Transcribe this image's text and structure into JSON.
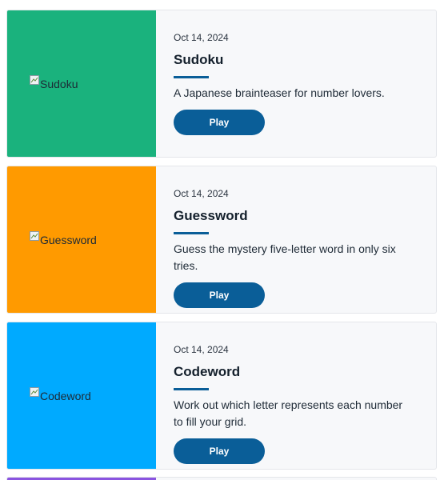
{
  "games": [
    {
      "image_alt": "Sudoku",
      "thumb_color": "#1ab27d",
      "date": "Oct 14, 2024",
      "title": "Sudoku",
      "description": "A Japanese brainteaser for number lovers.",
      "play_label": "Play"
    },
    {
      "image_alt": "Guessword",
      "thumb_color": "#ff9a00",
      "date": "Oct 14, 2024",
      "title": "Guessword",
      "description": "Guess the mystery five-letter word in only six tries.",
      "play_label": "Play"
    },
    {
      "image_alt": "Codeword",
      "thumb_color": "#00aaff",
      "date": "Oct 14, 2024",
      "title": "Codeword",
      "description": "Work out which letter represents each number to fill your grid.",
      "play_label": "Play"
    },
    {
      "thumb_color": "#8a54e0"
    }
  ],
  "accent_color": "#0a5e98",
  "broken_image_icon": "broken-image-icon"
}
